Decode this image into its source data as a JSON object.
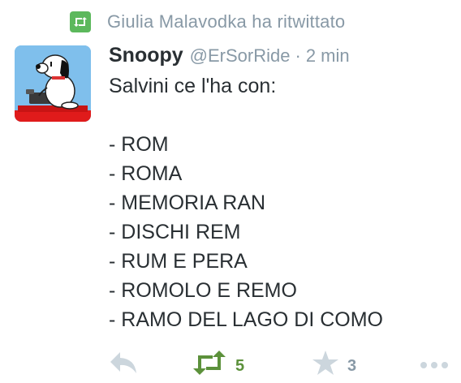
{
  "retweet_context": {
    "icon": "retweet-icon",
    "text": "Giulia Malavodka ha ritwittato",
    "badge_color": "#5cb85c"
  },
  "tweet": {
    "avatar_icon": "snoopy-avatar",
    "display_name": "Snoopy",
    "handle": "@ErSorRide",
    "separator": "·",
    "timestamp": "2 min",
    "text": "Salvini ce l'ha con:\n\n- ROM\n- ROMA\n- MEMORIA RAN\n- DISCHI REM\n- RUM E PERA\n- ROMOLO E REMO\n- RAMO DEL LAGO DI COMO"
  },
  "actions": {
    "reply_icon": "reply-icon",
    "retweet_icon": "retweet-icon",
    "retweet_count": "5",
    "retweet_color": "#5c913b",
    "favorite_icon": "star-icon",
    "favorite_count": "3",
    "more_icon": "more-dots-icon"
  }
}
